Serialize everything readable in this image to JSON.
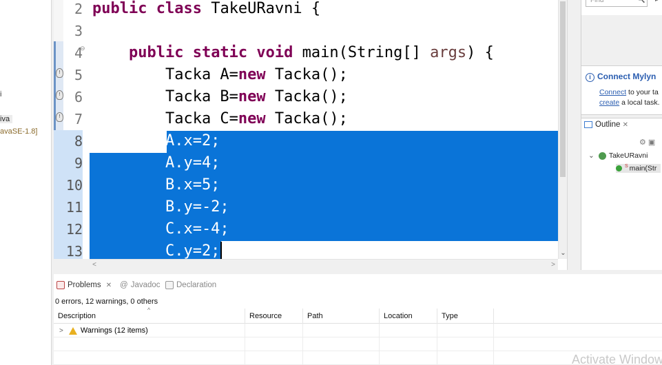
{
  "left_panel": {
    "fragments": [
      "i",
      "iva",
      "avaSE-1.8]"
    ]
  },
  "editor": {
    "lines": [
      {
        "num": "2",
        "tokens": [
          {
            "t": "public class",
            "k": "kw"
          },
          {
            "t": " TakeURavni {",
            "k": ""
          }
        ]
      },
      {
        "num": "3",
        "tokens": []
      },
      {
        "num": "4",
        "tokens": [
          {
            "t": "    ",
            "k": ""
          },
          {
            "t": "public static",
            "k": "kw"
          },
          {
            "t": " ",
            "k": ""
          },
          {
            "t": "void",
            "k": "kw"
          },
          {
            "t": " main(String[] ",
            "k": ""
          },
          {
            "t": "args",
            "k": "param"
          },
          {
            "t": ") {",
            "k": ""
          }
        ]
      },
      {
        "num": "5",
        "tokens": [
          {
            "t": "        Tacka A=",
            "k": ""
          },
          {
            "t": "new",
            "k": "kw"
          },
          {
            "t": " Tacka();",
            "k": ""
          }
        ]
      },
      {
        "num": "6",
        "tokens": [
          {
            "t": "        Tacka B=",
            "k": ""
          },
          {
            "t": "new",
            "k": "kw"
          },
          {
            "t": " Tacka();",
            "k": ""
          }
        ]
      },
      {
        "num": "7",
        "tokens": [
          {
            "t": "        Tacka C=",
            "k": ""
          },
          {
            "t": "new",
            "k": "kw"
          },
          {
            "t": " Tacka();",
            "k": ""
          }
        ]
      },
      {
        "num": "8",
        "text": "        A.x=2;",
        "selected": true
      },
      {
        "num": "9",
        "text": "        A.y=4;",
        "selected": true
      },
      {
        "num": "10",
        "text": "        B.x=5;",
        "selected": true
      },
      {
        "num": "11",
        "text": "        B.y=-2;",
        "selected": true
      },
      {
        "num": "12",
        "text": "        C.x=-4;",
        "selected": true
      },
      {
        "num": "13",
        "text": "        C.y=2;",
        "selected": true
      }
    ],
    "fold_marker": "⊖",
    "scroll_down": "⌄",
    "scroll_left": "<",
    "scroll_right": ">"
  },
  "right_panel": {
    "find_placeholder": "Find",
    "find_icon": "🔍",
    "find_more": "⊳",
    "mylyn": {
      "title": "Connect Mylyn",
      "info_icon": "i",
      "line1_link": "Connect",
      "line1_text": " to your ta",
      "line2_link": "create",
      "line2_text": " a local task."
    },
    "outline": {
      "tab_label": "Outline",
      "close": "✕",
      "tools": "⚙ ▣",
      "class_name": "TakeURavni",
      "expand": "⌄",
      "method": "main(Str",
      "method_mod": "S"
    }
  },
  "problems": {
    "tabs": [
      {
        "label": "Problems",
        "close": "✕",
        "active": true
      },
      {
        "label": "Javadoc",
        "active": false
      },
      {
        "label": "Declaration",
        "active": false
      }
    ],
    "summary": "0 errors, 12 warnings, 0 others",
    "sort_arrow": "^",
    "columns": [
      "Description",
      "Resource",
      "Path",
      "Location",
      "Type"
    ],
    "rows": [
      {
        "description": "Warnings (12 items)",
        "expander": ">"
      }
    ]
  },
  "watermark": "Activate Window",
  "colors": {
    "keyword": "#7f0055",
    "selection": "#0a74d8",
    "link": "#2a5db0"
  }
}
